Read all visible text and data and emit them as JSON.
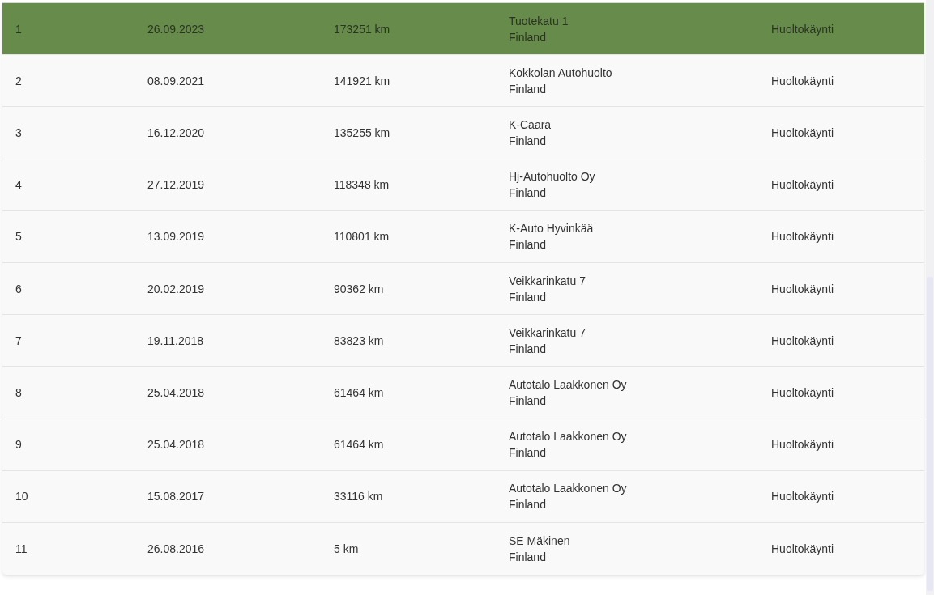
{
  "table": {
    "rows": [
      {
        "selected": true,
        "column_1": "1",
        "column_2": "26.09.2023",
        "column_3": "173251 km",
        "column_4": [
          "Tuotekatu 1",
          "Finland"
        ],
        "column_5": "Huoltokäynti"
      },
      {
        "selected": false,
        "column_1": "2",
        "column_2": "08.09.2021",
        "column_3": "141921 km",
        "column_4": [
          "Kokkolan Autohuolto",
          "Finland"
        ],
        "column_5": "Huoltokäynti"
      },
      {
        "selected": false,
        "column_1": "3",
        "column_2": "16.12.2020",
        "column_3": "135255 km",
        "column_4": [
          "K-Caara",
          "Finland"
        ],
        "column_5": "Huoltokäynti"
      },
      {
        "selected": false,
        "column_1": "4",
        "column_2": "27.12.2019",
        "column_3": "118348 km",
        "column_4": [
          "Hj-Autohuolto Oy",
          "Finland"
        ],
        "column_5": "Huoltokäynti"
      },
      {
        "selected": false,
        "column_1": "5",
        "column_2": "13.09.2019",
        "column_3": "110801 km",
        "column_4": [
          "K-Auto Hyvinkää",
          "Finland"
        ],
        "column_5": "Huoltokäynti"
      },
      {
        "selected": false,
        "column_1": "6",
        "column_2": "20.02.2019",
        "column_3": "90362 km",
        "column_4": [
          "Veikkarinkatu 7",
          "Finland"
        ],
        "column_5": "Huoltokäynti"
      },
      {
        "selected": false,
        "column_1": "7",
        "column_2": "19.11.2018",
        "column_3": "83823 km",
        "column_4": [
          "Veikkarinkatu 7",
          "Finland"
        ],
        "column_5": "Huoltokäynti"
      },
      {
        "selected": false,
        "column_1": "8",
        "column_2": "25.04.2018",
        "column_3": "61464 km",
        "column_4": [
          "Autotalo Laakkonen Oy",
          "Finland"
        ],
        "column_5": "Huoltokäynti"
      },
      {
        "selected": false,
        "column_1": "9",
        "column_2": "25.04.2018",
        "column_3": "61464 km",
        "column_4": [
          "Autotalo Laakkonen Oy",
          "Finland"
        ],
        "column_5": "Huoltokäynti"
      },
      {
        "selected": false,
        "column_1": "10",
        "column_2": "15.08.2017",
        "column_3": "33116 km",
        "column_4": [
          "Autotalo Laakkonen Oy",
          "Finland"
        ],
        "column_5": "Huoltokäynti"
      },
      {
        "selected": false,
        "column_1": "11",
        "column_2": "26.08.2016",
        "column_3": "5 km",
        "column_4": [
          "SE Mäkinen",
          "Finland"
        ],
        "column_5": "Huoltokäynti"
      }
    ]
  }
}
